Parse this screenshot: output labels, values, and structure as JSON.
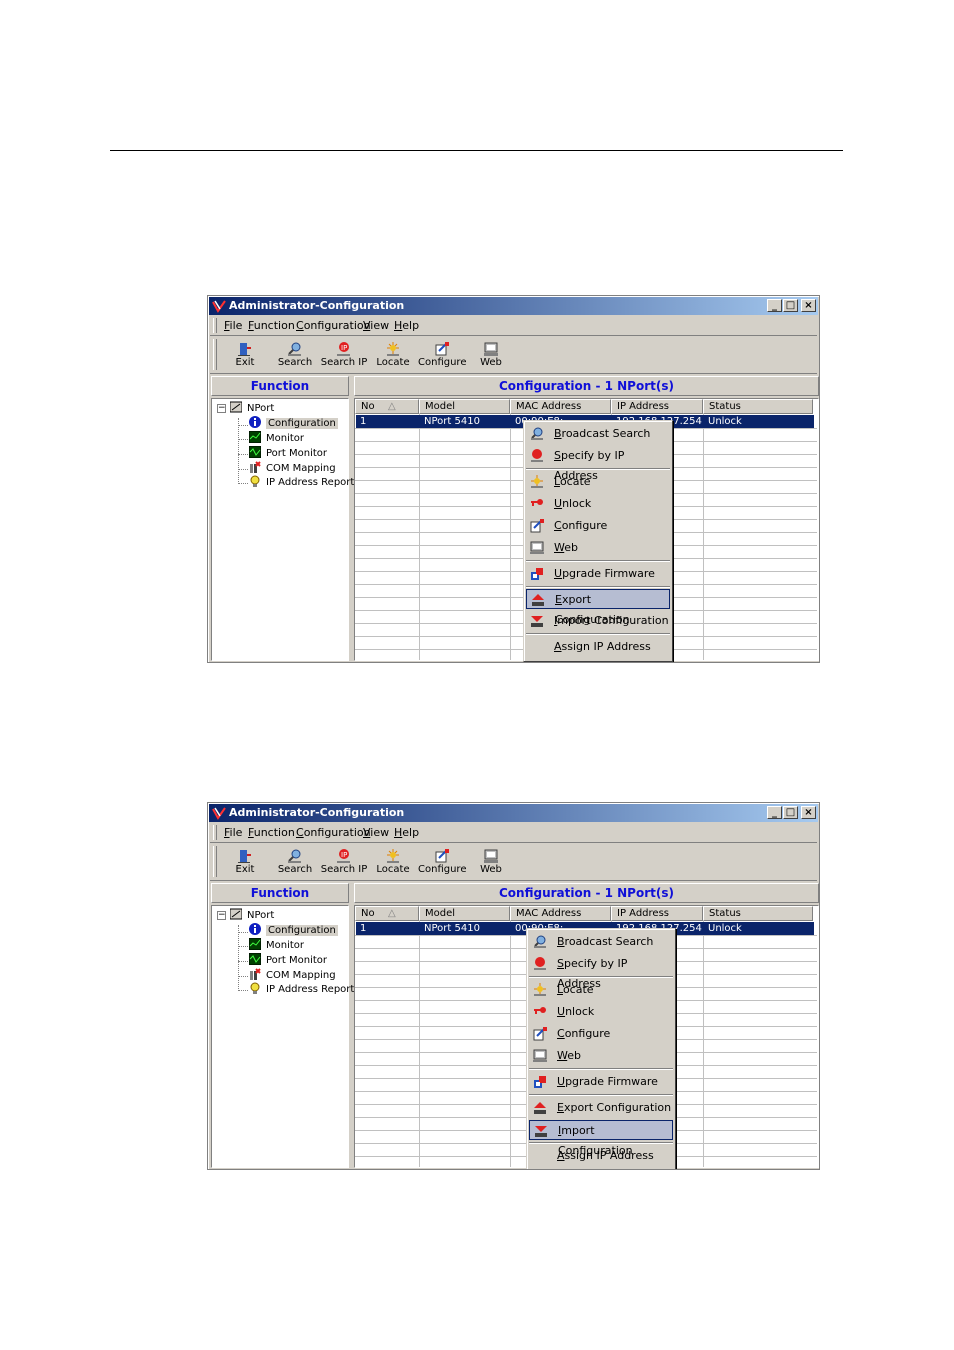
{
  "window": {
    "title": "Administrator-Configuration",
    "controls": [
      "_",
      "□",
      "×"
    ]
  },
  "menu": [
    "File",
    "Function",
    "Configuration",
    "View",
    "Help"
  ],
  "toolbar": [
    {
      "label": "Exit",
      "icon": "exit-icon"
    },
    {
      "label": "Search",
      "icon": "search-icon"
    },
    {
      "label": "Search IP",
      "icon": "search-ip-icon"
    },
    {
      "label": "Locate",
      "icon": "locate-icon"
    },
    {
      "label": "Configure",
      "icon": "configure-icon"
    },
    {
      "label": "Web",
      "icon": "web-icon"
    }
  ],
  "function_header": "Function",
  "config_header": "Configuration - 1 NPort(s)",
  "tree": {
    "root": "NPort",
    "items": [
      "Configuration",
      "Monitor",
      "Port Monitor",
      "COM Mapping",
      "IP Address Report"
    ]
  },
  "grid": {
    "columns": [
      "No",
      "Model",
      "MAC Address",
      "IP Address",
      "Status"
    ],
    "row": {
      "no": "1",
      "model": "NPort 5410",
      "mac": "00:90:E8:",
      "ip": "192.168.127.254",
      "status": "Unlock"
    }
  },
  "context_menu": {
    "items": [
      "Broadcast Search",
      "Specify by IP Address",
      "Locate",
      "Unlock",
      "Configure",
      "Web",
      "Upgrade Firmware",
      "Export Configuration",
      "Import Configuration",
      "Assign IP Address"
    ]
  },
  "screens": [
    {
      "highlighted": "Export Configuration"
    },
    {
      "highlighted": "Import Configuration"
    }
  ],
  "colors": {
    "title_start": "#0a246a",
    "title_end": "#a6caf0",
    "selection": "#0a246a",
    "header_text": "#1010d8",
    "menu_highlight": "#b6bdd2"
  }
}
